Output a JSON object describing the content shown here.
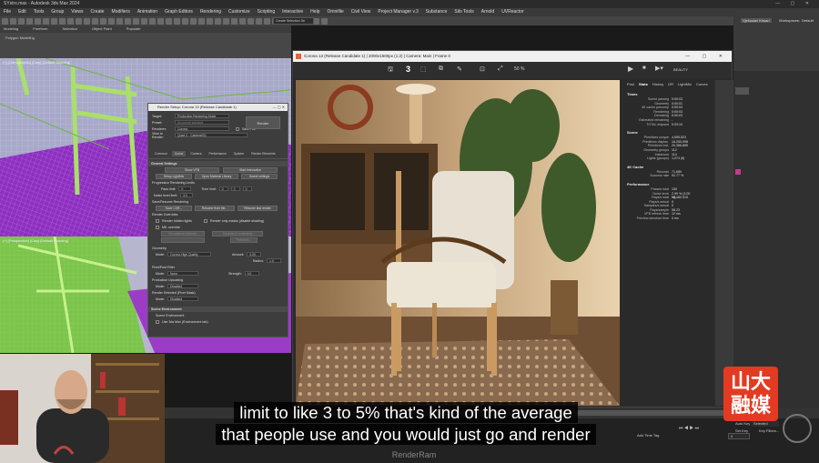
{
  "window": {
    "title": "SYstrs.max - Autodesk 3ds Max 2024",
    "menus": [
      "File",
      "Edit",
      "Tools",
      "Group",
      "Views",
      "Create",
      "Modifiers",
      "Animation",
      "Graph Editors",
      "Rendering",
      "Customize",
      "Scripting",
      "Interactive",
      "Help",
      "Omnifile",
      "Civil View",
      "Project Manager v.3",
      "Substance",
      "Silo Tools",
      "Arnold",
      "UVReactor"
    ],
    "user": "Vjekoslav Kirsan",
    "workspaces_label": "Workspaces:",
    "workspace_value": "Default",
    "selection_set": "Create Selection Se"
  },
  "ribbon": {
    "tabs": [
      "Modeling",
      "Freeform",
      "Selection",
      "Object Paint",
      "Populate"
    ],
    "panel_label": "Polygon Modeling"
  },
  "viewports": {
    "top_label": "[+] [Orthographic] [Clay] [Default Shading]",
    "bottom_label": "[+] [Perspective] [Clay] [Default Shading]"
  },
  "render_setup": {
    "title": "Render Setup: Corona 13 (Release Candidate 1)",
    "target_label": "Target:",
    "target_value": "Production Rendering Mode",
    "preset_label": "Preset:",
    "preset_value": "No preset selected",
    "renderer_label": "Renderer:",
    "renderer_value": "Corona",
    "save_file": "Save File",
    "render_button": "Render",
    "view_label": "View to Render:",
    "view_value": "Quad 4 - Camera001",
    "tabs": [
      "Common",
      "Scene",
      "Camera",
      "Performance",
      "System",
      "Render Elements"
    ],
    "active_tab": "Scene",
    "general_settings": "General Settings",
    "show_vfb": "Show VFB",
    "start_interactive": "Start Interactive",
    "setup_lightmix": "Setup LightMix",
    "open_material_library": "Open Material Library",
    "sweet_settings": "Sweet settings",
    "progressive_limits": "Progressive Rendering Limits",
    "pass_limit_label": "Pass limit:",
    "pass_limit_value": "0",
    "time_limit_label": "Time limit:",
    "time_limit_values": [
      "0",
      "0",
      "0"
    ],
    "noise_limit_label": "Noise level limit:",
    "noise_limit_value": "3.0",
    "save_resume": "Save/Resume Rendering",
    "save_cxr": "Save CXR...",
    "resume_from_file": "Resume from file...",
    "resume_last": "Resume last render",
    "render_override": "Render Overrides",
    "render_hidden": "Render hidden lights",
    "render_only_masks": "Render only masks (disable shading)",
    "mtl_override": "Mtl. override",
    "no_material": "No material selected",
    "exclude": "Exclude (0 excluded)",
    "preserve": "Preserve...",
    "geometry": "Geometry",
    "geo_mode_label": "Mode:",
    "geo_mode_value": "Corona High Quality",
    "amount_label": "Amount:",
    "amount_value": "0.00",
    "radius_label": "Radius:",
    "radius_value": "1.0",
    "postfilter": "Pixel/Post Filter",
    "pf_mode_value": "None",
    "strength_label": "Strength:",
    "strength_value": "0.0",
    "production_upscaling": "Production Upscaling",
    "pu_mode_value": "Disabled",
    "render_selected": "Render Selected (Pixel Mask)",
    "rs_mode_value": "Disabled",
    "scene_environment": "Scene Environment",
    "scene_env_sub": "Scene Environment",
    "use_3ds_env": "Use 3ds Max (Environment tab)"
  },
  "vfb": {
    "title": "Corona 13 (Release Candidate 1) | 2000x1500px (1:2) | Camera: Main | Frame 0",
    "pass_number": "3",
    "zoom": "50 %",
    "element": "BEAUTY",
    "side_tabs": [
      "Post",
      "Stats",
      "History",
      "DR",
      "LightMix",
      "Curves"
    ],
    "active_side_tab": "Stats",
    "times_header": "Times",
    "times": [
      {
        "k": "Scene parsing",
        "v": "0:00:03"
      },
      {
        "k": "Geometry",
        "v": "0:00:01"
      },
      {
        "k": "4K cache precomp",
        "v": "0:00:04"
      },
      {
        "k": "Rendering",
        "v": "0:00:03"
      },
      {
        "k": "Denoising",
        "v": "0:00:03"
      },
      {
        "k": "Estimated remaining",
        "v": "-"
      },
      {
        "k": "TOTAL elapsed",
        "v": "0:03:10"
      }
    ],
    "scene_header": "Scene",
    "scene": [
      {
        "k": "Primitives unique",
        "v": "4,595,523"
      },
      {
        "k": "Primitives displac.",
        "v": "16,250,098"
      },
      {
        "k": "Primitives inst.",
        "v": "20,366,889"
      },
      {
        "k": "Geometry groups",
        "v": "112"
      },
      {
        "k": "Instances",
        "v": "114"
      },
      {
        "k": "Lights (groups)",
        "v": "1,074 (8)"
      }
    ],
    "cache_header": "4K Cache",
    "cache": [
      {
        "k": "Records",
        "v": "71,680"
      },
      {
        "k": "Success rate",
        "v": "92.77 %"
      }
    ],
    "perf_header": "Performance",
    "perf": [
      {
        "k": "Passes total",
        "v": "150"
      },
      {
        "k": "Noise level",
        "v": "2.99 % (3.00 %)"
      },
      {
        "k": "Rays/s total",
        "v": "14,480,515"
      },
      {
        "k": "Rays/s actual",
        "v": "0"
      },
      {
        "k": "Samples/s actual",
        "v": "0"
      },
      {
        "k": "Rays/sample",
        "v": "58.23"
      },
      {
        "k": "VFB refresh time",
        "v": "12 ms"
      },
      {
        "k": "Preview denoiser time",
        "v": "0 ms"
      }
    ]
  },
  "timeline": {
    "frame_value": "0",
    "key_filters": "Key Filters...",
    "selected": "Selected",
    "auto_key": "Auto Key",
    "set_key": "Set Key",
    "add_time_tag": "Add Time Tag"
  },
  "subtitles": {
    "line1": "limit to like 3 to 5% that's kind of the average",
    "line2": "that people use and you would just go and render"
  },
  "watermark": "RenderRam",
  "logo": {
    "line1": "山大",
    "line2": "融媒"
  },
  "colors": {
    "vfb_bg": "#2b2b2b",
    "accent": "#e33a22",
    "grass": "#9bd16a",
    "purple": "#9b35c9"
  }
}
